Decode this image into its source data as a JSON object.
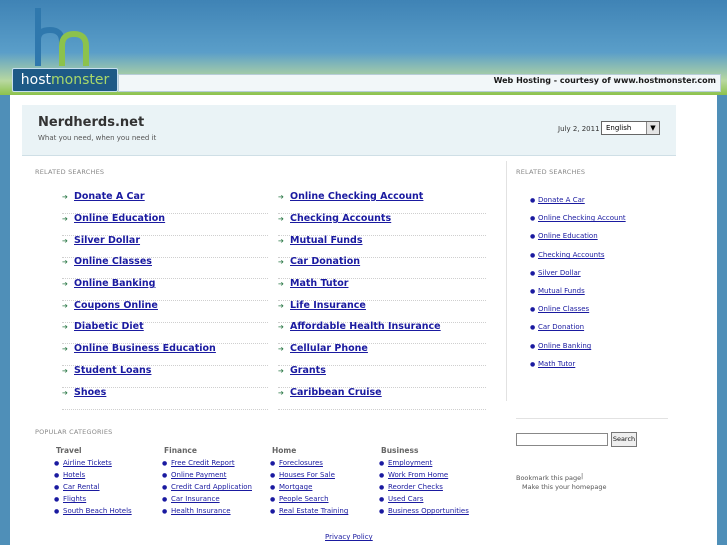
{
  "brand": {
    "logo_part1": "host",
    "logo_part2": "monster",
    "hosting_note": "Web Hosting - courtesy of www.hostmonster.com",
    "colors": {
      "logo_blue": "#2f78ad",
      "logo_green": "#8cc24c"
    }
  },
  "header": {
    "site_title": "Nerdherds.net",
    "tagline": "What you need, when you need it",
    "date": "July 2, 2011",
    "language": "English"
  },
  "main": {
    "section_label": "RELATED SEARCHES",
    "left_links": [
      "Donate A Car",
      "Online Education",
      "Silver Dollar",
      "Online Classes",
      "Online Banking",
      "Coupons Online",
      "Diabetic Diet",
      "Online Business Education",
      "Student Loans",
      "Shoes"
    ],
    "right_links": [
      "Online Checking Account",
      "Checking Accounts",
      "Mutual Funds",
      "Car Donation",
      "Math Tutor",
      "Life Insurance",
      "Affordable Health Insurance",
      "Cellular Phone",
      "Grants",
      "Caribbean Cruise"
    ]
  },
  "sidebar": {
    "section_label": "RELATED SEARCHES",
    "links": [
      "Donate A Car",
      "Online Checking Account",
      "Online Education",
      "Checking Accounts",
      "Silver Dollar",
      "Mutual Funds",
      "Online Classes",
      "Car Donation",
      "Online Banking",
      "Math Tutor"
    ],
    "search_button": "Search",
    "bookmark": "Bookmark this page",
    "homepage": "Make this your homepage"
  },
  "popular": {
    "section_label": "POPULAR CATEGORIES",
    "columns": [
      {
        "title": "Travel",
        "items": [
          "Airline Tickets",
          "Hotels",
          "Car Rental",
          "Flights",
          "South Beach Hotels"
        ]
      },
      {
        "title": "Finance",
        "items": [
          "Free Credit Report",
          "Online Payment",
          "Credit Card Application",
          "Car Insurance",
          "Health Insurance"
        ]
      },
      {
        "title": "Home",
        "items": [
          "Foreclosures",
          "Houses For Sale",
          "Mortgage",
          "People Search",
          "Real Estate Training"
        ]
      },
      {
        "title": "Business",
        "items": [
          "Employment",
          "Work From Home",
          "Reorder Checks",
          "Used Cars",
          "Business Opportunities"
        ]
      }
    ]
  },
  "footer": {
    "privacy": "Privacy Policy"
  }
}
